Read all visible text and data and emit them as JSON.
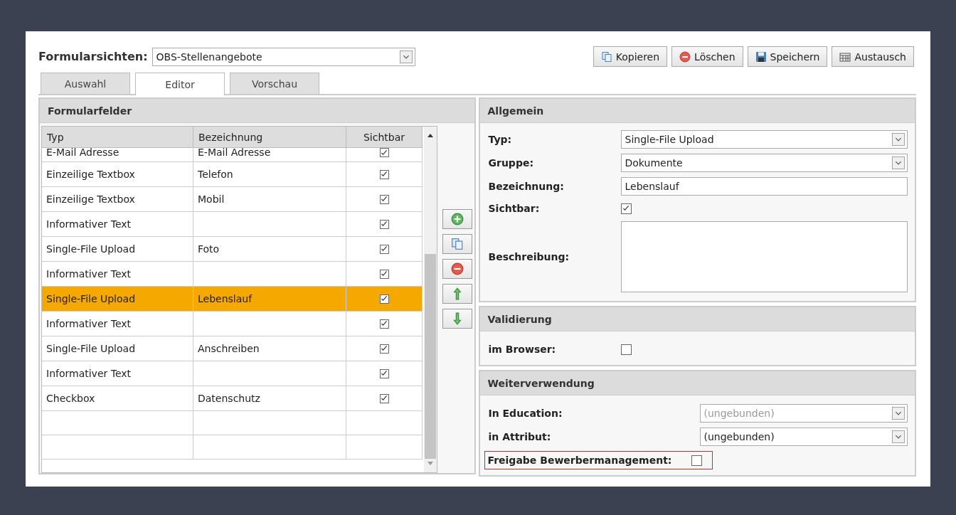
{
  "header": {
    "label": "Formularsichten:",
    "view_select": "OBS-Stellenangebote"
  },
  "actions": [
    {
      "label": "Kopieren",
      "kind": "copy"
    },
    {
      "label": "Löschen",
      "kind": "delete"
    },
    {
      "label": "Speichern",
      "kind": "save"
    },
    {
      "label": "Austausch",
      "kind": "exchange"
    }
  ],
  "tabs": [
    {
      "label": "Auswahl",
      "selected": false
    },
    {
      "label": "Editor",
      "selected": true
    },
    {
      "label": "Vorschau",
      "selected": false
    }
  ],
  "fields_panel": {
    "title": "Formularfelder",
    "columns": [
      "Typ",
      "Bezeichnung",
      "Sichtbar"
    ],
    "rows": [
      {
        "typ": "E-Mail Adresse",
        "bezeichnung": "E-Mail Adresse",
        "visible": true,
        "selected": false
      },
      {
        "typ": "Einzeilige Textbox",
        "bezeichnung": "Telefon",
        "visible": true,
        "selected": false
      },
      {
        "typ": "Einzeilige Textbox",
        "bezeichnung": "Mobil",
        "visible": true,
        "selected": false
      },
      {
        "typ": "Informativer Text",
        "visible": true,
        "selected": false
      },
      {
        "typ": "Single-File Upload",
        "bezeichnung": "Foto",
        "visible": true,
        "selected": false
      },
      {
        "typ": "Informativer Text",
        "visible": true,
        "selected": false
      },
      {
        "typ": "Single-File Upload",
        "bezeichnung": "Lebenslauf",
        "visible": true,
        "selected": true
      },
      {
        "typ": "Informativer Text",
        "visible": true,
        "selected": false
      },
      {
        "typ": "Single-File Upload",
        "bezeichnung": "Anschreiben",
        "visible": true,
        "selected": false
      },
      {
        "typ": "Informativer Text",
        "visible": true,
        "selected": false
      },
      {
        "typ": "Checkbox",
        "bezeichnung": "Datenschutz",
        "visible": true,
        "selected": false
      }
    ],
    "tools": [
      {
        "kind": "add"
      },
      {
        "kind": "duplicate"
      },
      {
        "kind": "remove"
      },
      {
        "kind": "up"
      },
      {
        "kind": "down"
      }
    ]
  },
  "sections": [
    {
      "title": "Allgemein",
      "fields": [
        {
          "kind": "select",
          "label": "Typ:",
          "value": "Single-File Upload",
          "disabled": false
        },
        {
          "kind": "select",
          "label": "Gruppe:",
          "value": "Dokumente",
          "disabled": false
        },
        {
          "kind": "input",
          "label": "Bezeichnung:",
          "value": "Lebenslauf"
        },
        {
          "kind": "checkbox",
          "label": "Sichtbar:",
          "checked": true,
          "highlighted": false
        },
        {
          "kind": "textarea",
          "label": "Beschreibung:"
        }
      ]
    },
    {
      "title": "Validierung",
      "fields": [
        {
          "kind": "checkbox",
          "label": "im Browser:",
          "checked": false,
          "highlighted": false
        }
      ]
    },
    {
      "title": "Weiterverwendung",
      "fields": [
        {
          "kind": "select",
          "label": "In Education:",
          "value": "(ungebunden)",
          "disabled": true
        },
        {
          "kind": "select",
          "label": "in Attribut:",
          "value": "(ungebunden)",
          "disabled": false
        },
        {
          "kind": "checkbox",
          "label": "Freigabe Bewerbermanagement:",
          "checked": false,
          "highlighted": true
        }
      ]
    }
  ]
}
